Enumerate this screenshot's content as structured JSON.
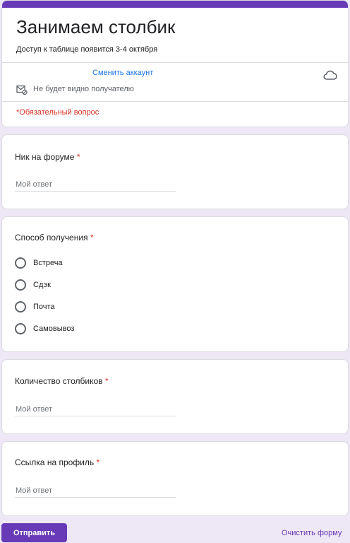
{
  "form": {
    "title": "Занимаем столбик",
    "description": "Доступ к таблице появится 3-4 октября",
    "switch_account": "Сменить аккаунт",
    "privacy_note": "Не будет видно получателю",
    "required_note": "*Обязательный вопрос"
  },
  "questions": [
    {
      "title": "Ник на форуме",
      "required": "*",
      "type": "text",
      "placeholder": "Мой ответ"
    },
    {
      "title": "Способ получения",
      "required": "*",
      "type": "radio",
      "options": [
        "Встреча",
        "Сдэк",
        "Почта",
        "Самовывоз"
      ]
    },
    {
      "title": "Количество столбиков",
      "required": "*",
      "type": "text",
      "placeholder": "Мой ответ"
    },
    {
      "title": "Ссылка на профиль",
      "required": "*",
      "type": "text",
      "placeholder": "Мой ответ"
    }
  ],
  "footer": {
    "submit_label": "Отправить",
    "clear_label": "Очистить форму"
  },
  "colors": {
    "accent": "#673ab7",
    "background": "#ede7f6",
    "required": "#d93025",
    "link": "#1a73e8"
  },
  "icons": {
    "cloud": "cloud-icon",
    "mail": "mail-off-icon"
  }
}
